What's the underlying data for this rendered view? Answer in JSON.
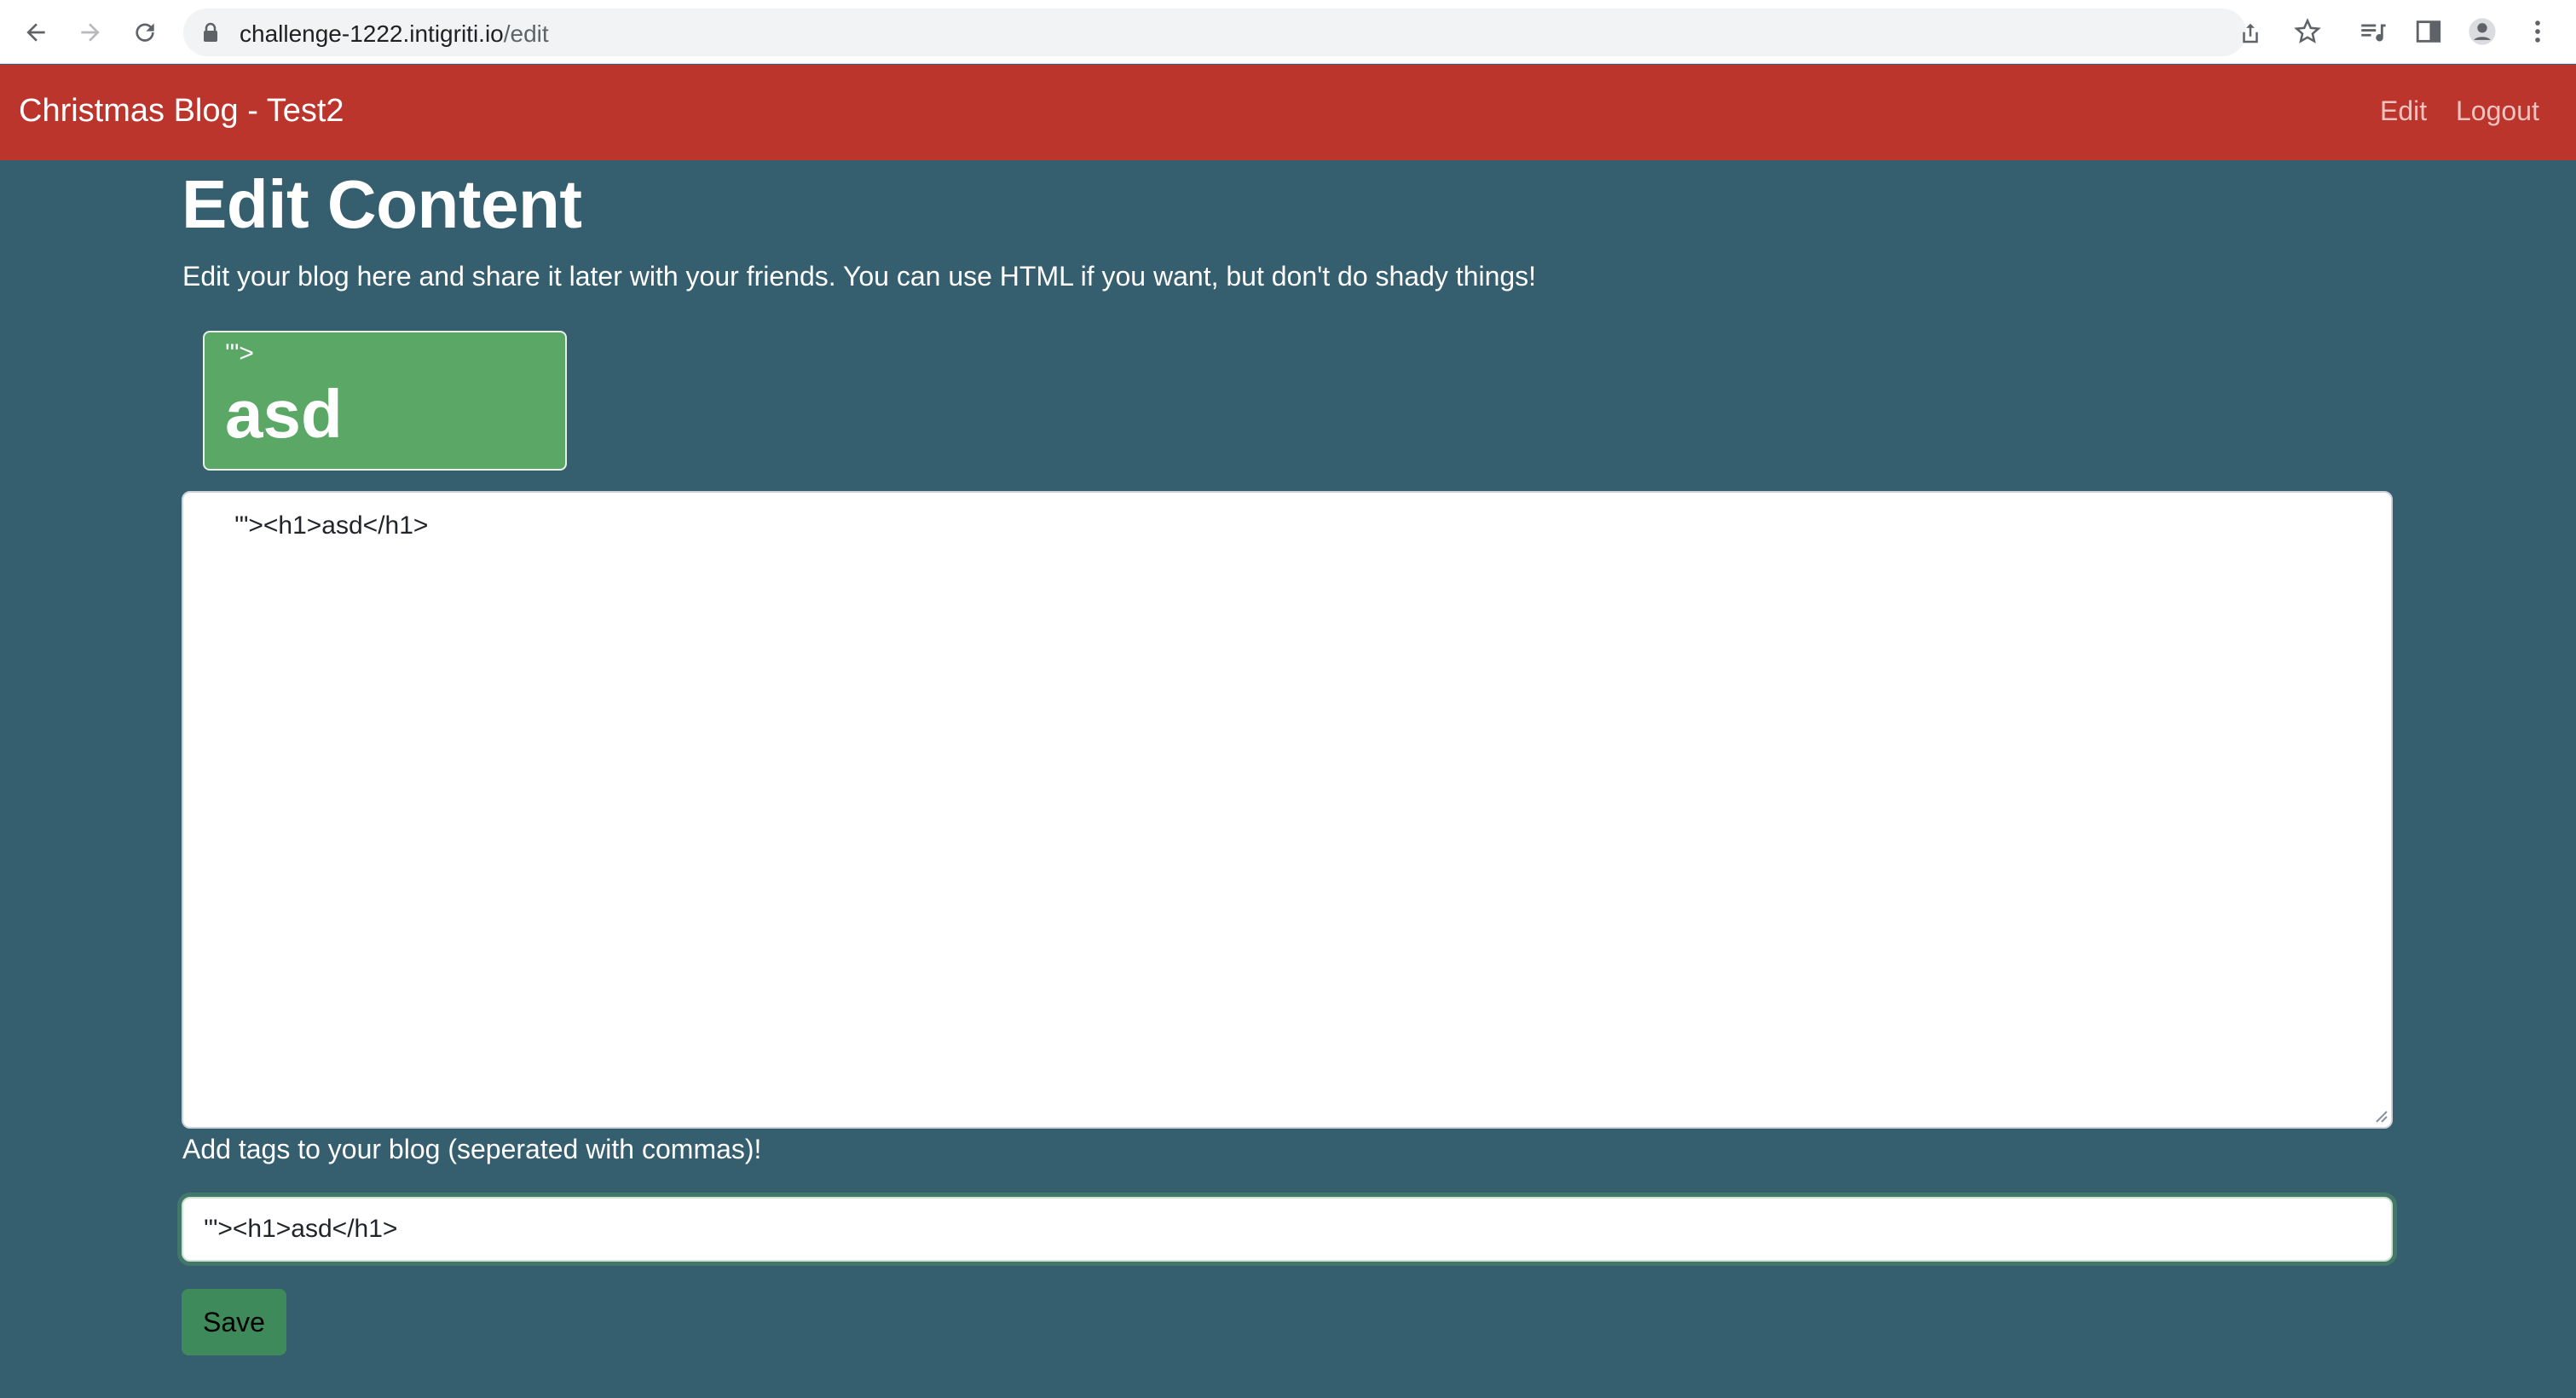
{
  "browser": {
    "url_host": "challenge-1222.intigriti.io",
    "url_path": "/edit"
  },
  "navbar": {
    "brand": "Christmas Blog - Test2",
    "links": [
      {
        "label": "Edit"
      },
      {
        "label": "Logout"
      }
    ]
  },
  "page": {
    "title": "Edit Content",
    "description": "Edit your blog here and share it later with your friends. You can use HTML if you want, but don't do shady things!"
  },
  "preview": {
    "prefix_text": "'\">",
    "heading_text": "asd"
  },
  "editor": {
    "content_value": "'\"><h1>asd</h1>"
  },
  "tags": {
    "label": "Add tags to your blog (seperated with commas)!",
    "value": "'\"><h1>asd</h1>"
  },
  "actions": {
    "save_label": "Save"
  },
  "colors": {
    "navbar": "#bb352c",
    "background": "#355e6e",
    "preview_card": "#5ba765",
    "save_button": "#3f8a5a"
  }
}
